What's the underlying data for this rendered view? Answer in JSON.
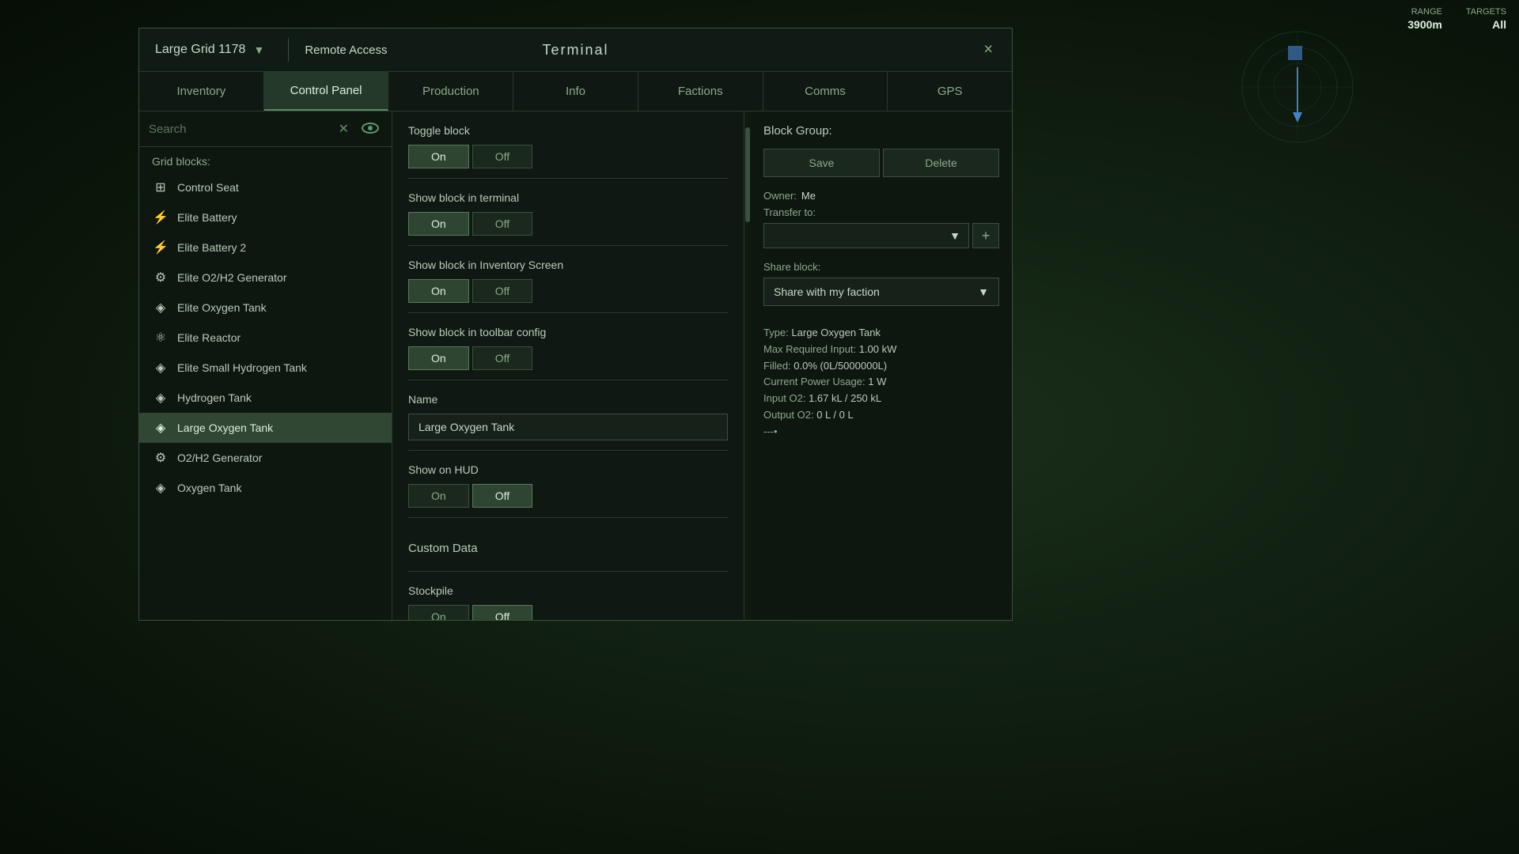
{
  "hud": {
    "range_label": "RANGE",
    "range_value": "3900m",
    "targets_label": "TARGETS",
    "targets_value": "All"
  },
  "terminal": {
    "title": "Terminal",
    "grid_name": "Large Grid 1178",
    "remote_access": "Remote Access",
    "close_label": "×"
  },
  "tabs": [
    {
      "id": "inventory",
      "label": "Inventory",
      "active": false
    },
    {
      "id": "control-panel",
      "label": "Control Panel",
      "active": true
    },
    {
      "id": "production",
      "label": "Production",
      "active": false
    },
    {
      "id": "info",
      "label": "Info",
      "active": false
    },
    {
      "id": "factions",
      "label": "Factions",
      "active": false
    },
    {
      "id": "comms",
      "label": "Comms",
      "active": false
    },
    {
      "id": "gps",
      "label": "GPS",
      "active": false
    }
  ],
  "search": {
    "placeholder": "Search",
    "value": ""
  },
  "grid_blocks_label": "Grid blocks:",
  "blocks": [
    {
      "name": "Control Seat",
      "icon": "⊞",
      "selected": false
    },
    {
      "name": "Elite Battery",
      "icon": "⚡",
      "selected": false
    },
    {
      "name": "Elite Battery 2",
      "icon": "⚡",
      "selected": false
    },
    {
      "name": "Elite O2/H2 Generator",
      "icon": "⚙",
      "selected": false
    },
    {
      "name": "Elite Oxygen Tank",
      "icon": "◈",
      "selected": false
    },
    {
      "name": "Elite Reactor",
      "icon": "⚛",
      "selected": false
    },
    {
      "name": "Elite Small Hydrogen Tank",
      "icon": "◈",
      "selected": false
    },
    {
      "name": "Hydrogen Tank",
      "icon": "◈",
      "selected": false
    },
    {
      "name": "Large Oxygen Tank",
      "icon": "◈",
      "selected": true
    },
    {
      "name": "O2/H2 Generator",
      "icon": "⚙",
      "selected": false
    },
    {
      "name": "Oxygen Tank",
      "icon": "◈",
      "selected": false
    }
  ],
  "controls": {
    "toggle_block": {
      "label": "Toggle block",
      "on_active": true,
      "on_label": "On",
      "off_label": "Off"
    },
    "show_in_terminal": {
      "label": "Show block in terminal",
      "on_active": true,
      "on_label": "On",
      "off_label": "Off"
    },
    "show_in_inventory": {
      "label": "Show block in Inventory Screen",
      "on_active": true,
      "on_label": "On",
      "off_label": "Off"
    },
    "show_in_toolbar": {
      "label": "Show block in toolbar config",
      "on_active": true,
      "on_label": "On",
      "off_label": "Off"
    },
    "name": {
      "label": "Name",
      "value": "Large Oxygen Tank"
    },
    "show_on_hud": {
      "label": "Show on HUD",
      "on_active": false,
      "on_label": "On",
      "off_label": "Off"
    },
    "custom_data": {
      "label": "Custom Data"
    },
    "stockpile": {
      "label": "Stockpile",
      "on_active": false,
      "on_label": "On",
      "off_label": "Off"
    }
  },
  "right_panel": {
    "block_group_label": "Block Group:",
    "save_label": "Save",
    "delete_label": "Delete",
    "owner_label": "Owner:",
    "owner_value": "Me",
    "transfer_label": "Transfer to:",
    "transfer_placeholder": "",
    "add_label": "+",
    "share_label": "Share block:",
    "share_value": "Share with my faction",
    "block_type_label": "Type:",
    "block_type_value": "Large Oxygen Tank",
    "max_input_label": "Max Required Input:",
    "max_input_value": "1.00 kW",
    "filled_label": "Filled:",
    "filled_value": "0.0% (0L/5000000L)",
    "power_label": "Current Power Usage:",
    "power_value": "1 W",
    "input_o2_label": "Input O2:",
    "input_o2_value": "1.67 kL / 250 kL",
    "output_o2_label": "Output O2:",
    "output_o2_value": "0 L / 0 L",
    "separator": "---•"
  }
}
